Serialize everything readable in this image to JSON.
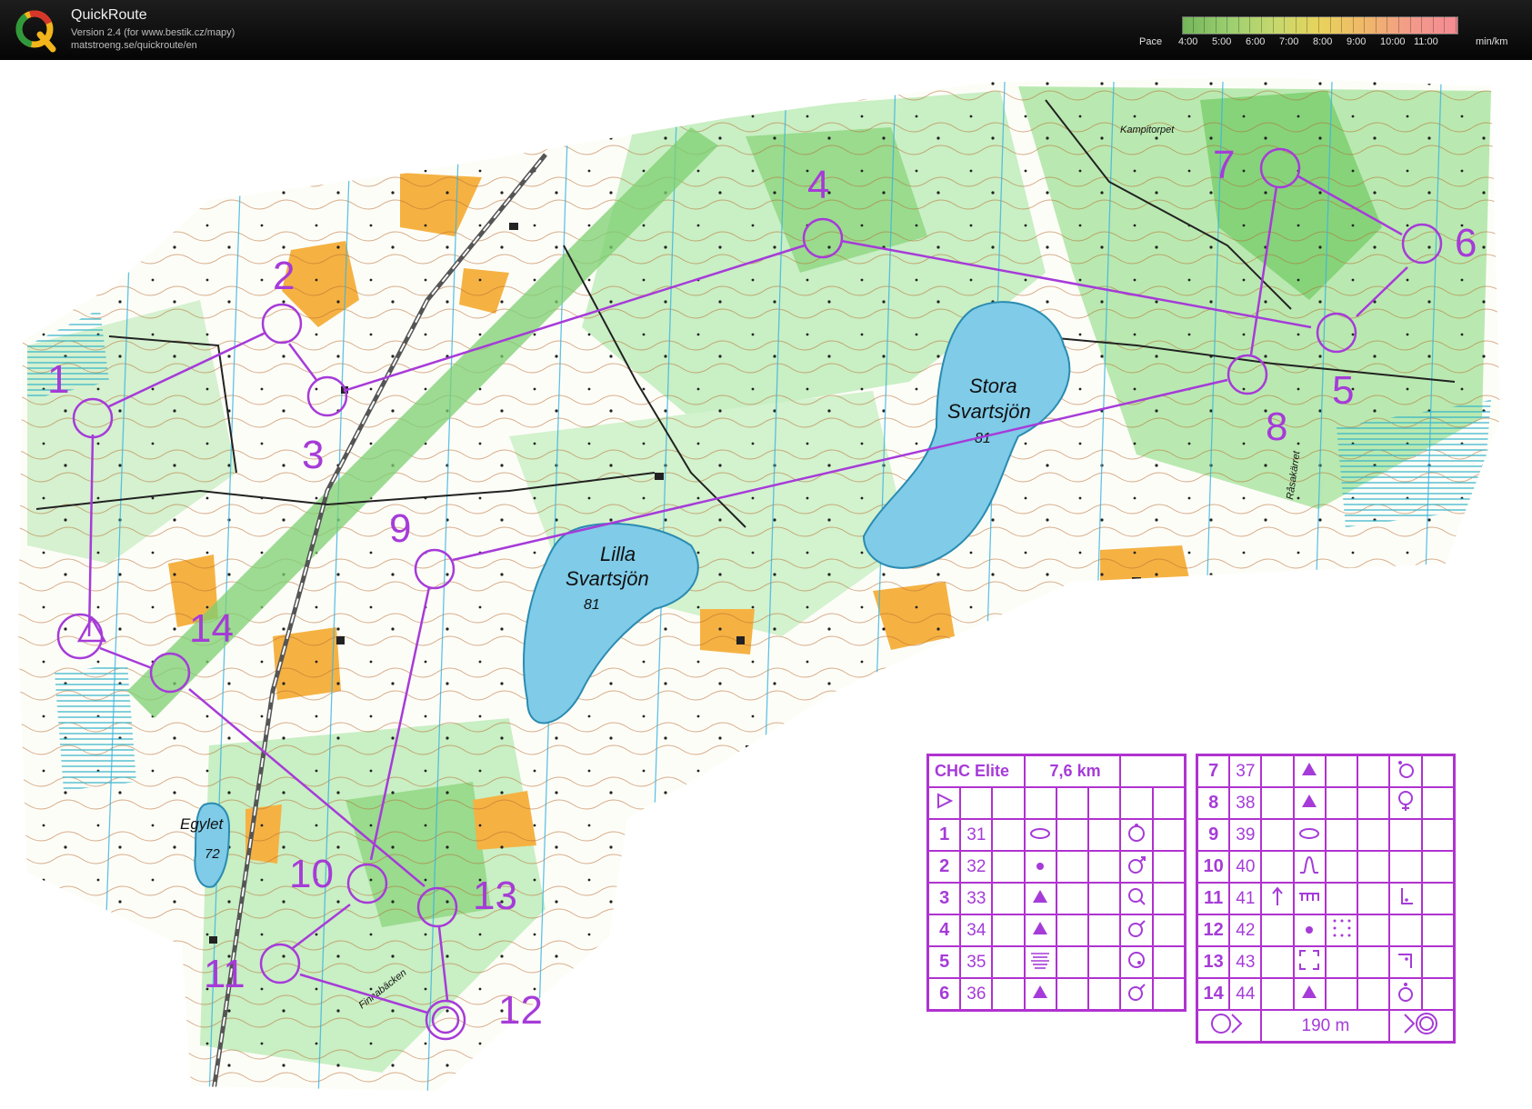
{
  "header": {
    "app_name": "QuickRoute",
    "version": "Version 2.4  (for www.bestik.cz/mapy)",
    "url": "matstroeng.se/quickroute/en",
    "pace_label": "Pace",
    "pace_values": [
      "4:00",
      "5:00",
      "6:00",
      "7:00",
      "8:00",
      "9:00",
      "10:00",
      "11:00"
    ],
    "pace_unit": "min/km"
  },
  "map": {
    "lakes": [
      {
        "name_line1": "Stora",
        "name_line2": "Svartsjön",
        "elevation": "81"
      },
      {
        "name_line1": "Lilla",
        "name_line2": "Svartsjön",
        "elevation": "81"
      },
      {
        "name_line1": "Egylet",
        "elevation": "72"
      }
    ],
    "place_names": [
      "Kampitorpet",
      "Råsakärret",
      "Finnabäcken"
    ],
    "controls": [
      "1",
      "2",
      "3",
      "4",
      "5",
      "6",
      "7",
      "8",
      "9",
      "10",
      "11",
      "12",
      "13",
      "14"
    ]
  },
  "description_sheet": {
    "class_name": "CHC Elite",
    "length": "7,6 km",
    "finish_distance": "190 m",
    "rows_left": [
      {
        "num": "1",
        "code": "31",
        "feature": "ellipse",
        "detail": "circle-dot"
      },
      {
        "num": "2",
        "code": "32",
        "feature": "dot",
        "detail": "circle-arrow"
      },
      {
        "num": "3",
        "code": "33",
        "feature": "triangle",
        "detail": "circle-tail"
      },
      {
        "num": "4",
        "code": "34",
        "feature": "triangle",
        "detail": "circle-arrow"
      },
      {
        "num": "5",
        "code": "35",
        "feature": "lines",
        "detail": "circle-dot"
      },
      {
        "num": "6",
        "code": "36",
        "feature": "triangle",
        "detail": "circle-arrow"
      }
    ],
    "rows_right": [
      {
        "num": "7",
        "code": "37",
        "feature": "triangle",
        "detail": "circle-top"
      },
      {
        "num": "8",
        "code": "38",
        "feature": "triangle",
        "detail": "circle-bottom"
      },
      {
        "num": "9",
        "code": "39",
        "feature": "ellipse",
        "detail": ""
      },
      {
        "num": "10",
        "code": "40",
        "feature": "bell",
        "detail": ""
      },
      {
        "num": "11",
        "code": "41",
        "feature": "fence",
        "detail": "corner"
      },
      {
        "num": "12",
        "code": "42",
        "feature": "dot",
        "detail": ""
      },
      {
        "num": "13",
        "code": "43",
        "feature": "brackets",
        "detail": "corner-top"
      },
      {
        "num": "14",
        "code": "44",
        "feature": "triangle",
        "detail": "circle-top"
      }
    ]
  },
  "colors": {
    "course": "#a63bd8",
    "forest_green": "#7ccf72",
    "light_green": "#c9efc4",
    "open_yellow": "#f5b243",
    "water": "#7fcbe8",
    "contour": "#b5692c"
  }
}
